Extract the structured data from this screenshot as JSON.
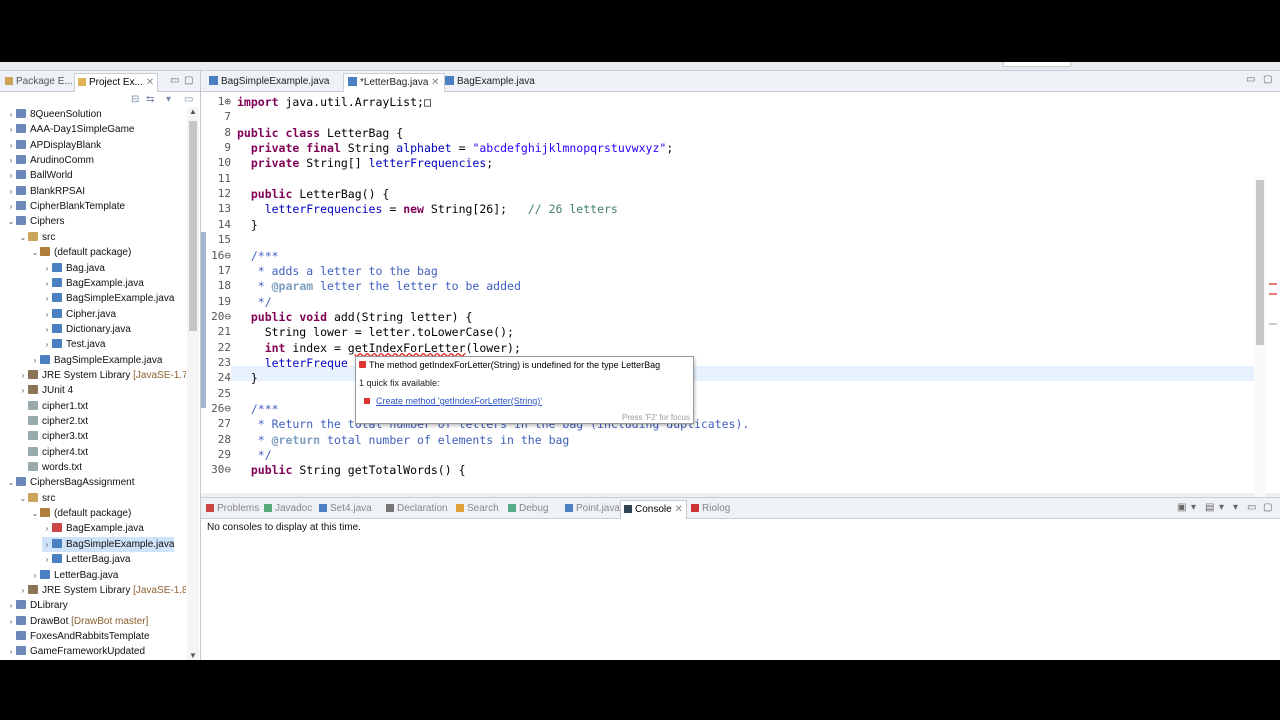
{
  "colors": {
    "accent": "#cfe3fb",
    "error": "#dd3333",
    "keyword": "#7f0055",
    "string": "#2a00ff",
    "comment": "#3f7f5f",
    "javadoc": "#3f5fbf"
  },
  "left_panel": {
    "tabs": [
      {
        "label": "Package E...",
        "icon": "package-icon"
      },
      {
        "label": "Project Ex...",
        "icon": "folder-icon",
        "active": true
      }
    ],
    "tree": [
      {
        "label": "8QueenSolution",
        "depth": 0,
        "twisty": "›",
        "icon": "project-icon"
      },
      {
        "label": "AAA-Day1SimpleGame",
        "depth": 0,
        "twisty": "›",
        "icon": "project-icon"
      },
      {
        "label": "APDisplayBlank",
        "depth": 0,
        "twisty": "›",
        "icon": "project-icon"
      },
      {
        "label": "ArudinoComm",
        "depth": 0,
        "twisty": "›",
        "icon": "project-icon"
      },
      {
        "label": "BallWorld",
        "depth": 0,
        "twisty": "›",
        "icon": "project-icon"
      },
      {
        "label": "BlankRPSAI",
        "depth": 0,
        "twisty": "›",
        "icon": "project-icon"
      },
      {
        "label": "CipherBlankTemplate",
        "depth": 0,
        "twisty": "›",
        "icon": "project-icon"
      },
      {
        "label": "Ciphers",
        "depth": 0,
        "twisty": "⌄",
        "icon": "project-icon"
      },
      {
        "label": "src",
        "depth": 1,
        "twisty": "⌄",
        "icon": "source-folder-icon"
      },
      {
        "label": "(default package)",
        "depth": 2,
        "twisty": "⌄",
        "icon": "package-icon"
      },
      {
        "label": "Bag.java",
        "depth": 3,
        "twisty": "›",
        "icon": "java-file-icon"
      },
      {
        "label": "BagExample.java",
        "depth": 3,
        "twisty": "›",
        "icon": "java-file-icon"
      },
      {
        "label": "BagSimpleExample.java",
        "depth": 3,
        "twisty": "›",
        "icon": "java-file-icon"
      },
      {
        "label": "Cipher.java",
        "depth": 3,
        "twisty": "›",
        "icon": "java-file-icon"
      },
      {
        "label": "Dictionary.java",
        "depth": 3,
        "twisty": "›",
        "icon": "java-file-icon"
      },
      {
        "label": "Test.java",
        "depth": 3,
        "twisty": "›",
        "icon": "java-file-icon"
      },
      {
        "label": "BagSimpleExample.java",
        "depth": 2,
        "twisty": "›",
        "icon": "java-file-icon"
      },
      {
        "label": "JRE System Library",
        "decoration": "[JavaSE-1.7]",
        "depth": 1,
        "twisty": "›",
        "icon": "library-icon"
      },
      {
        "label": "JUnit 4",
        "depth": 1,
        "twisty": "›",
        "icon": "library-icon"
      },
      {
        "label": "cipher1.txt",
        "depth": 1,
        "twisty": "",
        "icon": "text-file-icon"
      },
      {
        "label": "cipher2.txt",
        "depth": 1,
        "twisty": "",
        "icon": "text-file-icon"
      },
      {
        "label": "cipher3.txt",
        "depth": 1,
        "twisty": "",
        "icon": "text-file-icon"
      },
      {
        "label": "cipher4.txt",
        "depth": 1,
        "twisty": "",
        "icon": "text-file-icon"
      },
      {
        "label": "words.txt",
        "depth": 1,
        "twisty": "",
        "icon": "text-file-icon"
      },
      {
        "label": "CiphersBagAssignment",
        "depth": 0,
        "twisty": "⌄",
        "icon": "project-icon"
      },
      {
        "label": "src",
        "depth": 1,
        "twisty": "⌄",
        "icon": "source-folder-icon"
      },
      {
        "label": "(default package)",
        "depth": 2,
        "twisty": "⌄",
        "icon": "package-icon"
      },
      {
        "label": "BagExample.java",
        "depth": 3,
        "twisty": "›",
        "icon": "java-file-error-icon"
      },
      {
        "label": "BagSimpleExample.java",
        "depth": 3,
        "twisty": "›",
        "icon": "java-file-icon",
        "selected": true
      },
      {
        "label": "LetterBag.java",
        "depth": 3,
        "twisty": "›",
        "icon": "java-file-icon"
      },
      {
        "label": "LetterBag.java",
        "depth": 2,
        "twisty": "›",
        "icon": "java-file-icon"
      },
      {
        "label": "JRE System Library",
        "decoration": "[JavaSE-1.8]",
        "depth": 1,
        "twisty": "›",
        "icon": "library-icon"
      },
      {
        "label": "DLibrary",
        "depth": 0,
        "twisty": "›",
        "icon": "project-icon"
      },
      {
        "label": "DrawBot",
        "decoration": "[DrawBot master]",
        "depth": 0,
        "twisty": "›",
        "icon": "project-icon"
      },
      {
        "label": "FoxesAndRabbitsTemplate",
        "depth": 0,
        "twisty": "",
        "icon": "project-icon"
      },
      {
        "label": "GameFrameworkUpdated",
        "depth": 0,
        "twisty": "›",
        "icon": "project-icon"
      }
    ]
  },
  "editor": {
    "tabs": [
      {
        "label": "BagSimpleExample.java",
        "active": false
      },
      {
        "label": "*LetterBag.java",
        "active": true
      },
      {
        "label": "BagExample.java",
        "active": false
      }
    ],
    "lines": [
      {
        "n": "1⊕",
        "html": "<span class=\"kw\">import</span> java.util.ArrayList;□"
      },
      {
        "n": "7",
        "html": ""
      },
      {
        "n": "8",
        "html": "<span class=\"kw\">public class</span> LetterBag {"
      },
      {
        "n": "9",
        "html": "  <span class=\"kw\">private final</span> String <span class=\"fld\">alphabet</span> = <span class=\"str\">\"abcdefghijklmnopqrstuvwxyz\"</span>;"
      },
      {
        "n": "10",
        "html": "  <span class=\"kw\">private</span> String[] <span class=\"fld\">letterFrequencies</span>;"
      },
      {
        "n": "11",
        "html": ""
      },
      {
        "n": "12",
        "html": "  <span class=\"kw\">public</span> LetterBag() {"
      },
      {
        "n": "13",
        "html": "    <span class=\"fld\">letterFrequencies</span> = <span class=\"kw\">new</span> String[26];   <span class=\"cm\">// 26 letters</span>"
      },
      {
        "n": "14",
        "html": "  }"
      },
      {
        "n": "15",
        "html": ""
      },
      {
        "n": "16⊖",
        "html": "  <span class=\"jd\">/***</span>"
      },
      {
        "n": "17",
        "html": "<span class=\"jd\">   * adds a letter to the bag</span>"
      },
      {
        "n": "18",
        "html": "<span class=\"jd\">   * </span><span class=\"at\">@param</span><span class=\"jd\"> letter the letter to be added</span>"
      },
      {
        "n": "19",
        "html": "<span class=\"jd\">   */</span>"
      },
      {
        "n": "20⊖",
        "html": "  <span class=\"kw\">public void</span> add(String letter) {"
      },
      {
        "n": "21",
        "html": "    String lower = letter.toLowerCase();"
      },
      {
        "n": "22",
        "html": "    <span class=\"kw\">int</span> index = <span class=\"err\">getIndexForLetter</span>(lower);"
      },
      {
        "n": "23",
        "html": "    <span class=\"fld\">letterFreque</span>"
      },
      {
        "n": "24",
        "html": "  }"
      },
      {
        "n": "25",
        "html": ""
      },
      {
        "n": "26⊖",
        "html": "  <span class=\"jd\">/***</span>"
      },
      {
        "n": "27",
        "html": "<span class=\"jd\">   * Return the total number of letters in the bag (including duplicates).</span>"
      },
      {
        "n": "28",
        "html": "<span class=\"jd\">   * </span><span class=\"at\">@return</span><span class=\"jd\"> total number of elements in the bag</span>"
      },
      {
        "n": "29",
        "html": "<span class=\"jd\">   */</span>"
      },
      {
        "n": "30⊖",
        "html": "  <span class=\"kw\">public</span> String getTotalWords() {"
      }
    ],
    "hover": {
      "message": "The method getIndexForLetter(String) is undefined for the type LetterBag",
      "count": "1 quick fix available:",
      "fix": "Create method 'getIndexForLetter(String)'",
      "footer": "Press 'F2' for focus"
    }
  },
  "console": {
    "tabs": [
      {
        "label": "Problems",
        "icon": "problems-icon"
      },
      {
        "label": "Javadoc",
        "icon": "javadoc-icon"
      },
      {
        "label": "Set4.java",
        "icon": "java-file-icon"
      },
      {
        "label": "Declaration",
        "icon": "declaration-icon"
      },
      {
        "label": "Search",
        "icon": "search-icon"
      },
      {
        "label": "Debug",
        "icon": "debug-icon"
      },
      {
        "label": "Point.java",
        "icon": "java-file-icon"
      },
      {
        "label": "Console",
        "icon": "console-icon",
        "active": true
      },
      {
        "label": "Riolog",
        "icon": "riolog-icon"
      }
    ],
    "message": "No consoles to display at this time."
  }
}
